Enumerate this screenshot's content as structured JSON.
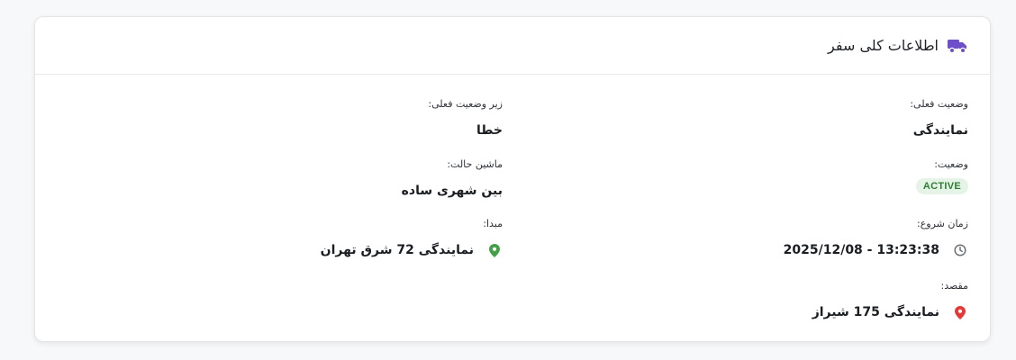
{
  "card": {
    "title": "اطلاعات کلی سفر",
    "title_icon": "truck-icon",
    "accent": "#6f4fc9"
  },
  "fields": {
    "current_status": {
      "label": "وضعیت فعلی:",
      "value": "نمایندگی"
    },
    "current_substatus": {
      "label": "زیر وضعیت فعلی:",
      "value": "خطا"
    },
    "status": {
      "label": "وضعیت:",
      "value": "ACTIVE"
    },
    "vehicle_state": {
      "label": "ماشین حالت:",
      "value": "بین شهری ساده"
    },
    "start_time": {
      "label": "زمان شروع:",
      "value": "2025/12/08 - 13:23:38",
      "icon": "clock-icon"
    },
    "origin": {
      "label": "مبدا:",
      "value": "نمایندگی 72 شرق تهران",
      "icon": "location-pin-icon",
      "icon_color": "#43a047"
    },
    "destination": {
      "label": "مقصد:",
      "value": "نمایندگی 175 شیراز",
      "icon": "location-pin-icon",
      "icon_color": "#e53935"
    }
  },
  "colors": {
    "badge_bg": "#e5f4e7",
    "badge_text": "#2e7d32"
  }
}
